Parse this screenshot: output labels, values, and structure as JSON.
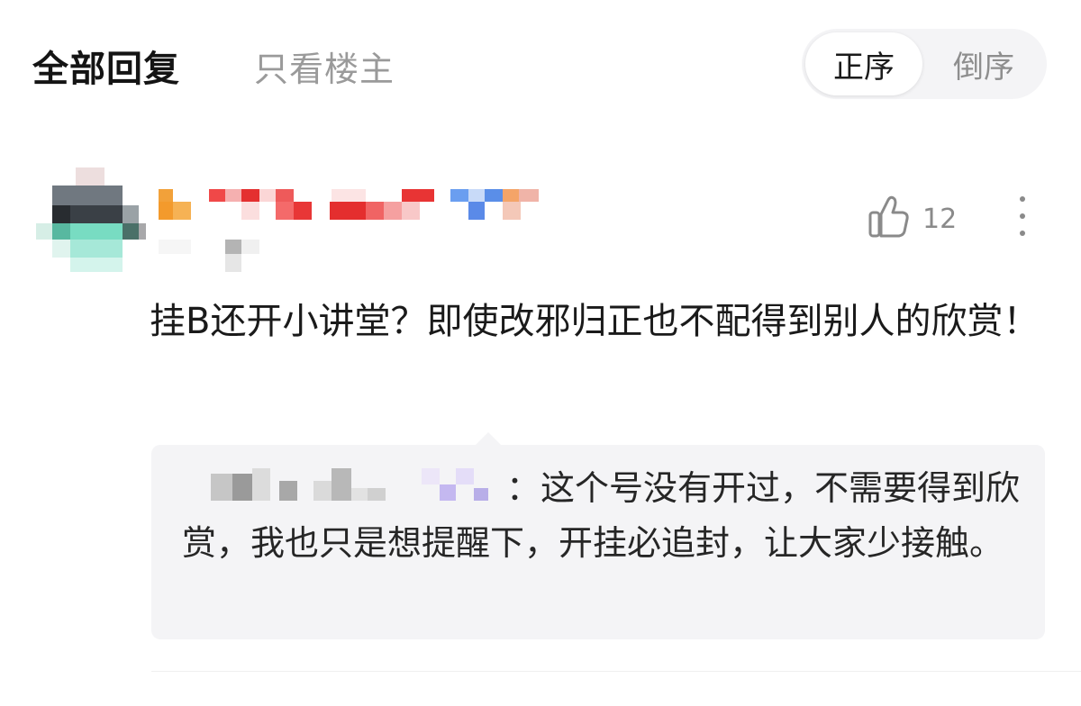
{
  "header": {
    "tabs": [
      {
        "label": "全部回复",
        "active": true
      },
      {
        "label": "只看楼主",
        "active": false
      }
    ],
    "sort": [
      {
        "label": "正序",
        "active": true
      },
      {
        "label": "倒序",
        "active": false
      }
    ]
  },
  "comment": {
    "avatar": "pixelated-avatar",
    "username": "pixelated-username",
    "like_count": "12",
    "text": "挂B还开小讲堂？即使改邪归正也不配得到别人的欣赏！",
    "reply": {
      "username": "pixelated-username",
      "text": "：这个号没有开过，不需要得到欣赏，我也只是想提醒下，开挂必追封，让大家少接触。"
    }
  },
  "colors": {
    "accent_text": "#1a1a1a",
    "muted_text": "#9a9a9a",
    "reply_bg": "#f4f4f6"
  },
  "icons": {
    "like": "thumbs-up-icon",
    "more": "more-vertical-icon"
  }
}
